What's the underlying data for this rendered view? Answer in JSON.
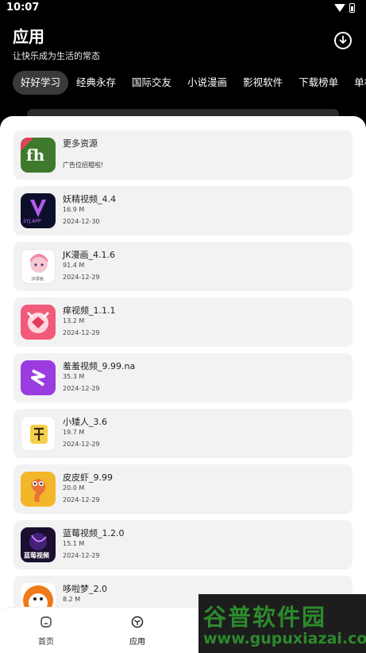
{
  "status": {
    "time": "10:07"
  },
  "header": {
    "title": "应用",
    "subtitle": "让快乐成为生活的常态"
  },
  "tabs": [
    "好好学习",
    "经典永存",
    "国际交友",
    "小说漫画",
    "影视软件",
    "下载榜单",
    "单机"
  ],
  "ad": {
    "name": "更多资源",
    "text": "广告位招租啦!",
    "icon_text": "fh"
  },
  "apps": [
    {
      "name": "妖精视频_4.4",
      "size": "16.9 M",
      "date": "2024-12-30",
      "icon_text": "2YJ.APP"
    },
    {
      "name": "JK漫画_4.1.6",
      "size": "91.4 M",
      "date": "2024-12-29",
      "icon_text": "JK漫画"
    },
    {
      "name": "痒视频_1.1.1",
      "size": "13.2 M",
      "date": "2024-12-29"
    },
    {
      "name": "羞羞视频_9.99.na",
      "size": "35.3 M",
      "date": "2024-12-29"
    },
    {
      "name": "小矮人_3.6",
      "size": "19.7 M",
      "date": "2024-12-29"
    },
    {
      "name": "皮皮虾_9.99",
      "size": "20.0 M",
      "date": "2024-12-29"
    },
    {
      "name": "蓝莓视频_1.2.0",
      "size": "15.1 M",
      "date": "2024-12-29",
      "icon_text": "蓝莓视频"
    },
    {
      "name": "哆啦梦_2.0",
      "size": "8.2 M",
      "date": ""
    }
  ],
  "nav": {
    "home": "首页",
    "apps": "应用"
  },
  "watermark": {
    "main": "谷普软件园",
    "url": "www.gupuxiazai.com"
  },
  "colors": {
    "ad_green": "#3f7a2c",
    "purple": "#9a3ce0",
    "yellow": "#f2b629",
    "watermark_green": "#2c8a2c"
  }
}
